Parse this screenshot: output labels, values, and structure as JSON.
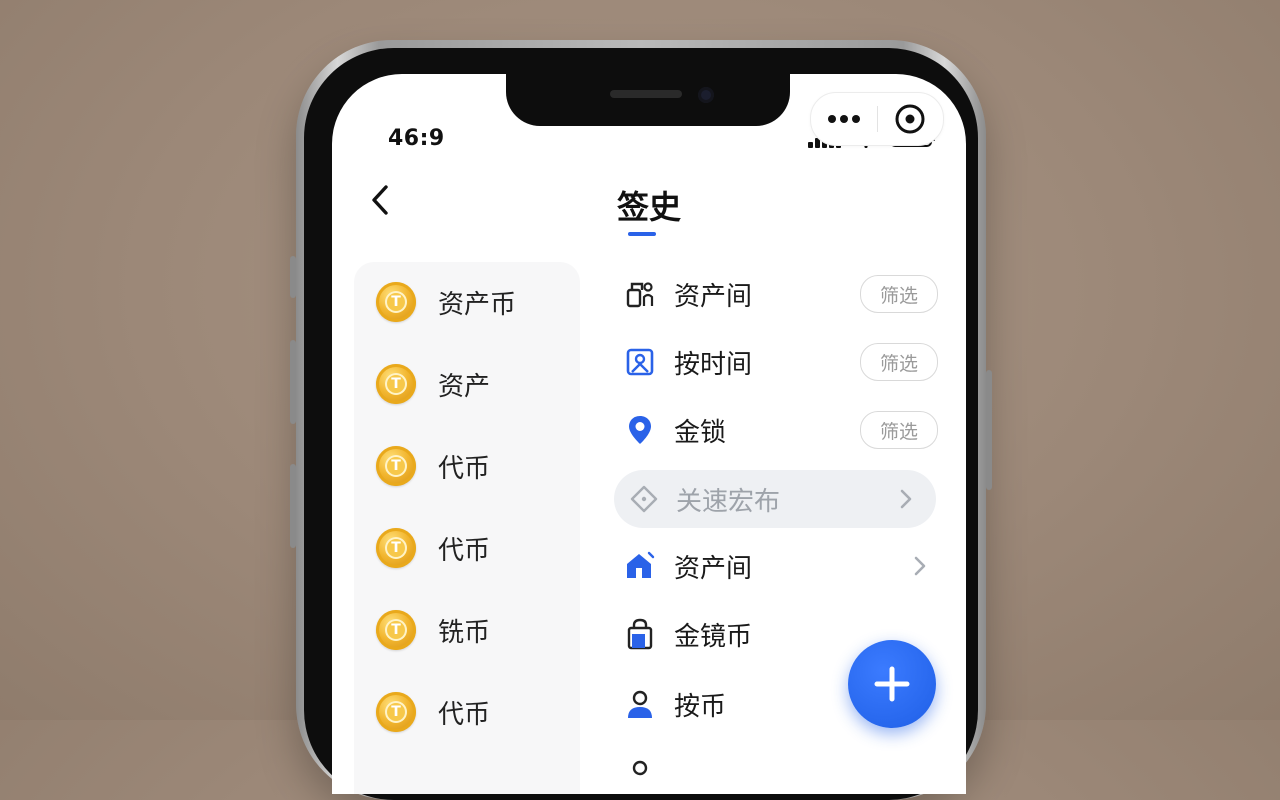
{
  "status_bar": {
    "time": "46:9"
  },
  "header": {
    "title": "签史"
  },
  "left_list": [
    {
      "label": "资产币"
    },
    {
      "label": "资产"
    },
    {
      "label": "代币"
    },
    {
      "label": "代币"
    },
    {
      "label": "铣币"
    },
    {
      "label": "代币"
    }
  ],
  "right_list": {
    "filter_label": "筛选",
    "rows": [
      {
        "label": "资产间",
        "icon": "building-user-icon"
      },
      {
        "label": "按时间",
        "icon": "portrait-icon"
      },
      {
        "label": "金锁",
        "icon": "location-pin-icon"
      }
    ],
    "search": {
      "label": "关速宏布",
      "icon": "diamond-icon"
    },
    "nav_rows": [
      {
        "label": "资产间",
        "icon": "house-icon"
      },
      {
        "label": "金镜币",
        "icon": "bag-icon"
      },
      {
        "label": "按币",
        "icon": "person-icon"
      }
    ]
  },
  "colors": {
    "accent": "#2a62e8",
    "coin": "#f2b630"
  }
}
